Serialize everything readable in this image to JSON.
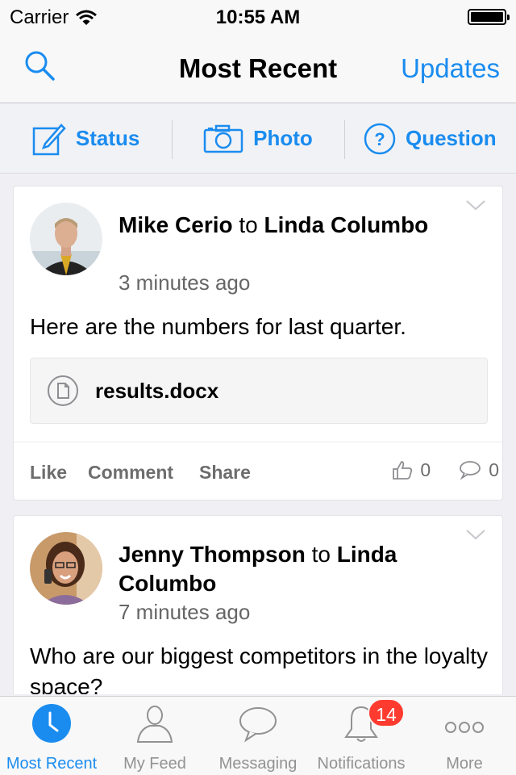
{
  "status_bar": {
    "carrier": "Carrier",
    "time": "10:55 AM"
  },
  "nav": {
    "title": "Most Recent",
    "right_button": "Updates",
    "search_icon": "search-icon"
  },
  "compose": {
    "status_label": "Status",
    "photo_label": "Photo",
    "question_label": "Question"
  },
  "posts": [
    {
      "author": "Mike Cerio",
      "connector": "to",
      "recipient": "Linda Columbo",
      "time": "3 minutes ago",
      "body": "Here are the numbers for last quarter.",
      "attachment": "results.docx",
      "like_label": "Like",
      "comment_label": "Comment",
      "share_label": "Share",
      "like_count": "0",
      "comment_count": "0"
    },
    {
      "author": "Jenny Thompson",
      "connector": "to",
      "recipient": "Linda Columbo",
      "time": "7 minutes ago",
      "body": "Who are our biggest competitors in the loyalty space?"
    }
  ],
  "tabs": [
    {
      "label": "Most Recent",
      "icon": "clock-icon"
    },
    {
      "label": "My Feed",
      "icon": "person-icon"
    },
    {
      "label": "Messaging",
      "icon": "speech-bubble-icon"
    },
    {
      "label": "Notifications",
      "icon": "bell-icon",
      "badge": "14"
    },
    {
      "label": "More",
      "icon": "ellipsis-icon"
    }
  ],
  "colors": {
    "accent": "#1a8cf0",
    "badge": "#ff3b30"
  }
}
